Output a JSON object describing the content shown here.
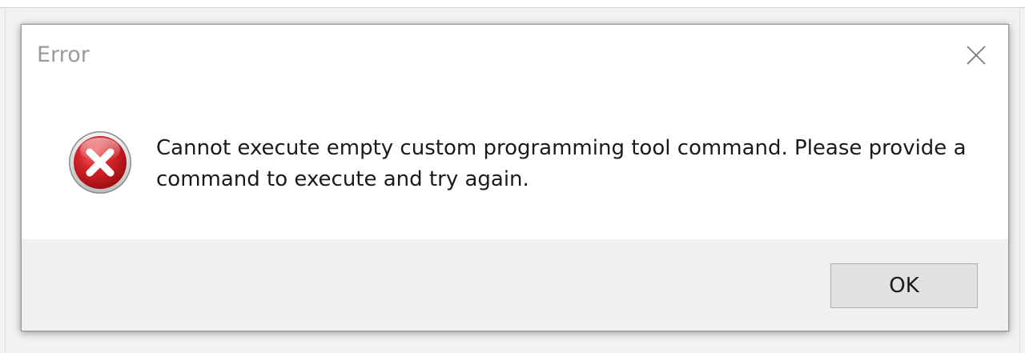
{
  "dialog": {
    "title": "Error",
    "message_line1": "Cannot execute empty custom programming tool command. Please provide a",
    "message_line2": "command to execute and try again.",
    "ok_label": "OK",
    "icon": "error-x-icon",
    "close_icon": "close-icon"
  },
  "colors": {
    "title_text": "#9b9b9b",
    "error_red": "#c8161d",
    "footer_bg": "#f0f0f0",
    "button_bg": "#e1e1e1"
  }
}
